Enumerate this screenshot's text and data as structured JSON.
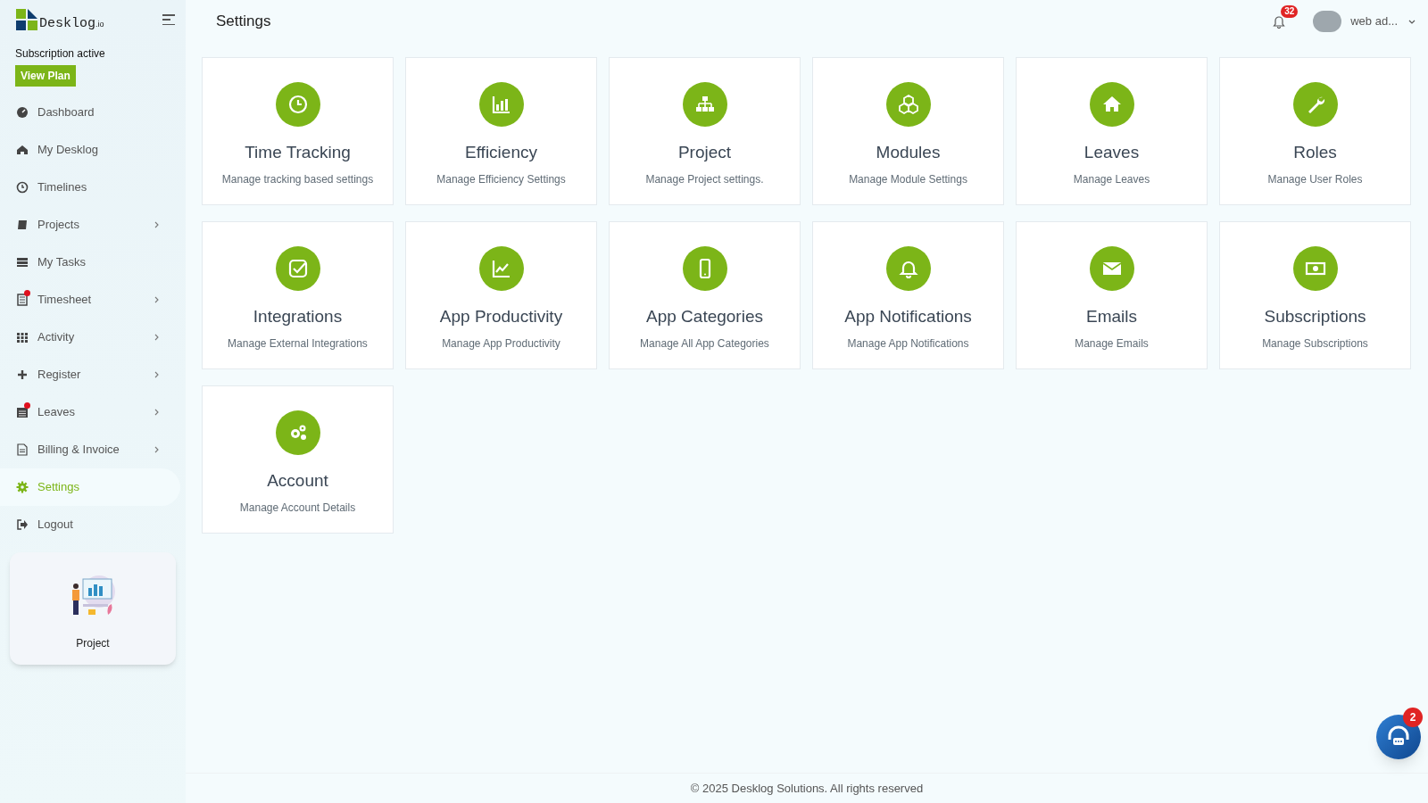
{
  "sidebar": {
    "logo": "Desklog",
    "logo_suffix": ".io",
    "subscription": "Subscription active",
    "view_plan": "View Plan",
    "items": [
      {
        "label": "Dashboard",
        "expandable": false,
        "dot": false,
        "selected": false
      },
      {
        "label": "My Desklog",
        "expandable": false,
        "dot": false,
        "selected": false
      },
      {
        "label": "Timelines",
        "expandable": false,
        "dot": false,
        "selected": false
      },
      {
        "label": "Projects",
        "expandable": true,
        "dot": false,
        "selected": false
      },
      {
        "label": "My Tasks",
        "expandable": false,
        "dot": false,
        "selected": false
      },
      {
        "label": "Timesheet",
        "expandable": true,
        "dot": true,
        "selected": false
      },
      {
        "label": "Activity",
        "expandable": true,
        "dot": false,
        "selected": false
      },
      {
        "label": "Register",
        "expandable": true,
        "dot": false,
        "selected": false
      },
      {
        "label": "Leaves",
        "expandable": true,
        "dot": true,
        "selected": false
      },
      {
        "label": "Billing & Invoice",
        "expandable": true,
        "dot": false,
        "selected": false
      },
      {
        "label": "Settings",
        "expandable": false,
        "dot": false,
        "selected": true
      },
      {
        "label": "Logout",
        "expandable": false,
        "dot": false,
        "selected": false
      }
    ],
    "promo": {
      "label": "Project"
    }
  },
  "header": {
    "title": "Settings",
    "notifications": "32",
    "user": "web ad..."
  },
  "cards": [
    {
      "title": "Time Tracking",
      "subtitle": "Manage tracking based settings"
    },
    {
      "title": "Efficiency",
      "subtitle": "Manage Efficiency Settings"
    },
    {
      "title": "Project",
      "subtitle": "Manage Project settings."
    },
    {
      "title": "Modules",
      "subtitle": "Manage Module Settings"
    },
    {
      "title": "Leaves",
      "subtitle": "Manage Leaves"
    },
    {
      "title": "Roles",
      "subtitle": "Manage User Roles"
    },
    {
      "title": "Integrations",
      "subtitle": "Manage External Integrations"
    },
    {
      "title": "App Productivity",
      "subtitle": "Manage App Productivity"
    },
    {
      "title": "App Categories",
      "subtitle": "Manage All App Categories"
    },
    {
      "title": "App Notifications",
      "subtitle": "Manage App Notifications"
    },
    {
      "title": "Emails",
      "subtitle": "Manage Emails"
    },
    {
      "title": "Subscriptions",
      "subtitle": "Manage Subscriptions"
    },
    {
      "title": "Account",
      "subtitle": "Manage Account Details"
    }
  ],
  "chat": {
    "badge": "2"
  },
  "footer": "© 2025 Desklog Solutions. All rights reserved"
}
